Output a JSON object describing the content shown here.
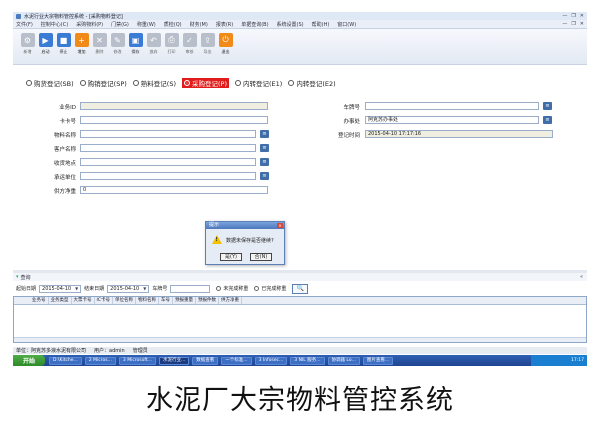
{
  "window": {
    "title": "水泥行业大宗物料管控系统 - [采购物料登记]",
    "controls": [
      "—",
      "❐",
      "✕"
    ]
  },
  "menu": {
    "items": [
      "文件(F)",
      "控制中心(C)",
      "采购物料(P)",
      "门禁(G)",
      "称重(W)",
      "质检(Q)",
      "财务(M)",
      "报表(R)",
      "单据查询(B)",
      "系统设置(S)",
      "帮助(H)",
      "窗口(W)"
    ],
    "mdi_controls": [
      "—",
      "❐",
      "✕"
    ]
  },
  "toolbar": {
    "buttons": [
      {
        "label": "新增",
        "icon": "gear",
        "enabled": false,
        "style": "gray"
      },
      {
        "label": "启动",
        "icon": "play",
        "enabled": true,
        "style": "blue"
      },
      {
        "label": "停止",
        "icon": "stop",
        "enabled": true,
        "style": "blue"
      },
      {
        "label": "增加",
        "icon": "add",
        "enabled": true,
        "style": "orange"
      },
      {
        "label": "删除",
        "icon": "delete",
        "enabled": false,
        "style": "gray"
      },
      {
        "label": "修改",
        "icon": "edit",
        "enabled": false,
        "style": "gray"
      },
      {
        "label": "保存",
        "icon": "save",
        "enabled": true,
        "style": "blue"
      },
      {
        "label": "放弃",
        "icon": "undo",
        "enabled": false,
        "style": "gray"
      },
      {
        "label": "打印",
        "icon": "print",
        "enabled": false,
        "style": "gray"
      },
      {
        "label": "审核",
        "icon": "check",
        "enabled": false,
        "style": "gray"
      },
      {
        "label": "导出",
        "icon": "export",
        "enabled": false,
        "style": "gray"
      },
      {
        "label": "退出",
        "icon": "power",
        "enabled": true,
        "style": "orange"
      }
    ]
  },
  "modes": {
    "options": [
      "购货登记(SB)",
      "购销登记(SP)",
      "熟料登记(S)",
      "采购登记(P)",
      "内转登记(E1)",
      "内转登记(E2)"
    ],
    "selected": "采购登记(P)"
  },
  "form": {
    "left": [
      {
        "label": "业务ID",
        "value": "",
        "readonly": true,
        "picker": false
      },
      {
        "label": "卡卡号",
        "value": "",
        "readonly": false,
        "picker": false
      },
      {
        "label": "物料名称",
        "value": "",
        "readonly": false,
        "picker": true
      },
      {
        "label": "客户名称",
        "value": "",
        "readonly": false,
        "picker": true
      },
      {
        "label": "收货地点",
        "value": "",
        "readonly": false,
        "picker": true
      },
      {
        "label": "承运单位",
        "value": "",
        "readonly": false,
        "picker": true
      },
      {
        "label": "供方净重",
        "value": "0",
        "readonly": false,
        "picker": false
      }
    ],
    "right": [
      {
        "label": "车牌号",
        "value": "",
        "readonly": false,
        "picker": true
      },
      {
        "label": "办事处",
        "value": "阿克苏办事处",
        "readonly": false,
        "picker": true
      },
      {
        "label": "登记时间",
        "value": "2015-04-10 17:17:16",
        "readonly": true,
        "picker": false
      }
    ]
  },
  "dialog": {
    "title": "提示",
    "close": "✕",
    "message": "数据未保存是否继续?",
    "yes_label": "是(Y)",
    "no_label": "否(N)",
    "warn_mark": "!"
  },
  "query": {
    "title": "查询",
    "collapse": "«",
    "start_label": "起始日期",
    "start_date": "2015-04-10",
    "end_label": "结束日期",
    "end_date": "2015-04-10",
    "plate_label": "车牌号",
    "plate_value": "",
    "radio_1": "未完成称重",
    "radio_2": "已完成称重",
    "search_icon": "🔍",
    "dropdown_icon": "▼",
    "columns": [
      "业务号",
      "业务类型",
      "大票卡号",
      "IC卡号",
      "单位名称",
      "物料名称",
      "车号",
      "预报重量",
      "预报件数",
      "供方净重"
    ]
  },
  "status": {
    "company": "单位：阿克苏多浪水泥有限公司",
    "user_label": "用户：",
    "user": "admin",
    "role": "管理员"
  },
  "taskbar": {
    "start": "开始",
    "tasks": [
      "D:\\Kitche...",
      "2 Micros...",
      "3 Microsoft...",
      "水泥行业...",
      "数据查看",
      "一个标准...",
      "3 Infosec...",
      "3 NIL 服务...",
      "协调器 Lo...",
      "图片查看..."
    ],
    "active_index": 3,
    "tray_time": "17:17"
  },
  "caption": "水泥厂大宗物料管控系统"
}
